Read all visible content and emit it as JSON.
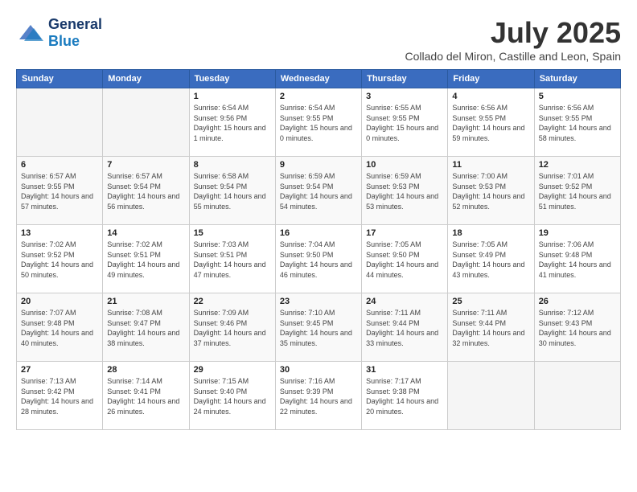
{
  "header": {
    "logo_general": "General",
    "logo_blue": "Blue",
    "month_title": "July 2025",
    "subtitle": "Collado del Miron, Castille and Leon, Spain"
  },
  "days_of_week": [
    "Sunday",
    "Monday",
    "Tuesday",
    "Wednesday",
    "Thursday",
    "Friday",
    "Saturday"
  ],
  "weeks": [
    [
      {
        "day": "",
        "empty": true
      },
      {
        "day": "",
        "empty": true
      },
      {
        "day": "1",
        "sunrise": "Sunrise: 6:54 AM",
        "sunset": "Sunset: 9:56 PM",
        "daylight": "Daylight: 15 hours and 1 minute."
      },
      {
        "day": "2",
        "sunrise": "Sunrise: 6:54 AM",
        "sunset": "Sunset: 9:55 PM",
        "daylight": "Daylight: 15 hours and 0 minutes."
      },
      {
        "day": "3",
        "sunrise": "Sunrise: 6:55 AM",
        "sunset": "Sunset: 9:55 PM",
        "daylight": "Daylight: 15 hours and 0 minutes."
      },
      {
        "day": "4",
        "sunrise": "Sunrise: 6:56 AM",
        "sunset": "Sunset: 9:55 PM",
        "daylight": "Daylight: 14 hours and 59 minutes."
      },
      {
        "day": "5",
        "sunrise": "Sunrise: 6:56 AM",
        "sunset": "Sunset: 9:55 PM",
        "daylight": "Daylight: 14 hours and 58 minutes."
      }
    ],
    [
      {
        "day": "6",
        "sunrise": "Sunrise: 6:57 AM",
        "sunset": "Sunset: 9:55 PM",
        "daylight": "Daylight: 14 hours and 57 minutes."
      },
      {
        "day": "7",
        "sunrise": "Sunrise: 6:57 AM",
        "sunset": "Sunset: 9:54 PM",
        "daylight": "Daylight: 14 hours and 56 minutes."
      },
      {
        "day": "8",
        "sunrise": "Sunrise: 6:58 AM",
        "sunset": "Sunset: 9:54 PM",
        "daylight": "Daylight: 14 hours and 55 minutes."
      },
      {
        "day": "9",
        "sunrise": "Sunrise: 6:59 AM",
        "sunset": "Sunset: 9:54 PM",
        "daylight": "Daylight: 14 hours and 54 minutes."
      },
      {
        "day": "10",
        "sunrise": "Sunrise: 6:59 AM",
        "sunset": "Sunset: 9:53 PM",
        "daylight": "Daylight: 14 hours and 53 minutes."
      },
      {
        "day": "11",
        "sunrise": "Sunrise: 7:00 AM",
        "sunset": "Sunset: 9:53 PM",
        "daylight": "Daylight: 14 hours and 52 minutes."
      },
      {
        "day": "12",
        "sunrise": "Sunrise: 7:01 AM",
        "sunset": "Sunset: 9:52 PM",
        "daylight": "Daylight: 14 hours and 51 minutes."
      }
    ],
    [
      {
        "day": "13",
        "sunrise": "Sunrise: 7:02 AM",
        "sunset": "Sunset: 9:52 PM",
        "daylight": "Daylight: 14 hours and 50 minutes."
      },
      {
        "day": "14",
        "sunrise": "Sunrise: 7:02 AM",
        "sunset": "Sunset: 9:51 PM",
        "daylight": "Daylight: 14 hours and 49 minutes."
      },
      {
        "day": "15",
        "sunrise": "Sunrise: 7:03 AM",
        "sunset": "Sunset: 9:51 PM",
        "daylight": "Daylight: 14 hours and 47 minutes."
      },
      {
        "day": "16",
        "sunrise": "Sunrise: 7:04 AM",
        "sunset": "Sunset: 9:50 PM",
        "daylight": "Daylight: 14 hours and 46 minutes."
      },
      {
        "day": "17",
        "sunrise": "Sunrise: 7:05 AM",
        "sunset": "Sunset: 9:50 PM",
        "daylight": "Daylight: 14 hours and 44 minutes."
      },
      {
        "day": "18",
        "sunrise": "Sunrise: 7:05 AM",
        "sunset": "Sunset: 9:49 PM",
        "daylight": "Daylight: 14 hours and 43 minutes."
      },
      {
        "day": "19",
        "sunrise": "Sunrise: 7:06 AM",
        "sunset": "Sunset: 9:48 PM",
        "daylight": "Daylight: 14 hours and 41 minutes."
      }
    ],
    [
      {
        "day": "20",
        "sunrise": "Sunrise: 7:07 AM",
        "sunset": "Sunset: 9:48 PM",
        "daylight": "Daylight: 14 hours and 40 minutes."
      },
      {
        "day": "21",
        "sunrise": "Sunrise: 7:08 AM",
        "sunset": "Sunset: 9:47 PM",
        "daylight": "Daylight: 14 hours and 38 minutes."
      },
      {
        "day": "22",
        "sunrise": "Sunrise: 7:09 AM",
        "sunset": "Sunset: 9:46 PM",
        "daylight": "Daylight: 14 hours and 37 minutes."
      },
      {
        "day": "23",
        "sunrise": "Sunrise: 7:10 AM",
        "sunset": "Sunset: 9:45 PM",
        "daylight": "Daylight: 14 hours and 35 minutes."
      },
      {
        "day": "24",
        "sunrise": "Sunrise: 7:11 AM",
        "sunset": "Sunset: 9:44 PM",
        "daylight": "Daylight: 14 hours and 33 minutes."
      },
      {
        "day": "25",
        "sunrise": "Sunrise: 7:11 AM",
        "sunset": "Sunset: 9:44 PM",
        "daylight": "Daylight: 14 hours and 32 minutes."
      },
      {
        "day": "26",
        "sunrise": "Sunrise: 7:12 AM",
        "sunset": "Sunset: 9:43 PM",
        "daylight": "Daylight: 14 hours and 30 minutes."
      }
    ],
    [
      {
        "day": "27",
        "sunrise": "Sunrise: 7:13 AM",
        "sunset": "Sunset: 9:42 PM",
        "daylight": "Daylight: 14 hours and 28 minutes."
      },
      {
        "day": "28",
        "sunrise": "Sunrise: 7:14 AM",
        "sunset": "Sunset: 9:41 PM",
        "daylight": "Daylight: 14 hours and 26 minutes."
      },
      {
        "day": "29",
        "sunrise": "Sunrise: 7:15 AM",
        "sunset": "Sunset: 9:40 PM",
        "daylight": "Daylight: 14 hours and 24 minutes."
      },
      {
        "day": "30",
        "sunrise": "Sunrise: 7:16 AM",
        "sunset": "Sunset: 9:39 PM",
        "daylight": "Daylight: 14 hours and 22 minutes."
      },
      {
        "day": "31",
        "sunrise": "Sunrise: 7:17 AM",
        "sunset": "Sunset: 9:38 PM",
        "daylight": "Daylight: 14 hours and 20 minutes."
      },
      {
        "day": "",
        "empty": true
      },
      {
        "day": "",
        "empty": true
      }
    ]
  ]
}
